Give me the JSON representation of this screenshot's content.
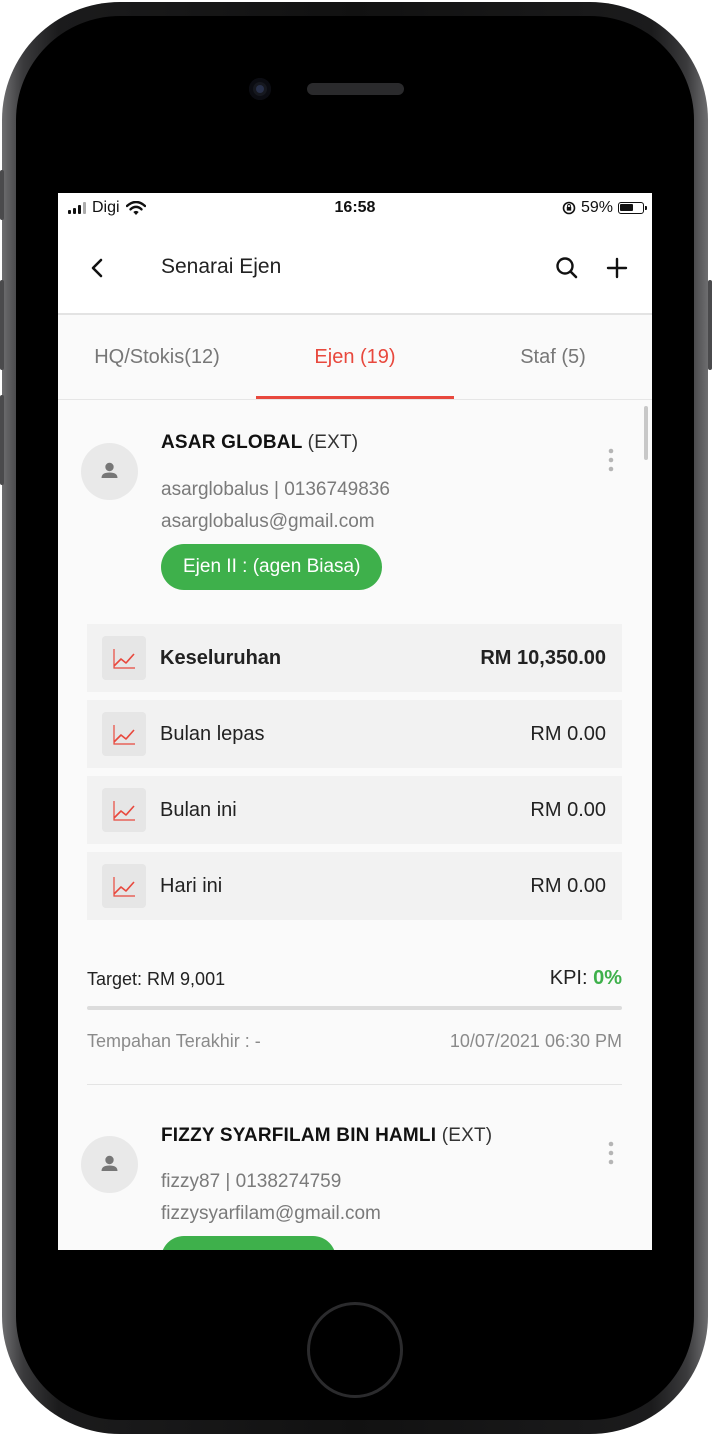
{
  "status_bar": {
    "carrier": "Digi",
    "time": "16:58",
    "battery": "59%"
  },
  "header": {
    "title": "Senarai Ejen",
    "icons": [
      "chevron-left-icon",
      "search-icon",
      "plus-icon"
    ]
  },
  "tabs": [
    {
      "label": "HQ/Stokis(12)",
      "active": false
    },
    {
      "label": "Ejen (19)",
      "active": true
    },
    {
      "label": "Staf (5)",
      "active": false
    }
  ],
  "colors": {
    "accent": "#e8483d",
    "badge": "#3eb04b",
    "kpi": "#3eb04b"
  },
  "agents": [
    {
      "name": "ASAR GLOBAL",
      "tag": "(EXT)",
      "username_phone": "asarglobalus | 0136749836",
      "email": "asarglobalus@gmail.com",
      "level": "Ejen II : (agen Biasa)",
      "stats": [
        {
          "label": "Keseluruhan",
          "value": "RM 10,350.00"
        },
        {
          "label": "Bulan lepas",
          "value": "RM 0.00"
        },
        {
          "label": "Bulan ini",
          "value": "RM 0.00"
        },
        {
          "label": "Hari ini",
          "value": "RM 0.00"
        }
      ],
      "target_label": "Target:",
      "target_value": "RM 9,001",
      "kpi_label": "KPI:",
      "kpi_value": "0%",
      "kpi_fraction": 0,
      "last_order": "Tempahan Terakhir : -",
      "last_date": "10/07/2021 06:30 PM"
    },
    {
      "name": "FIZZY SYARFILAM BIN HAMLI",
      "tag": "(EXT)",
      "username_phone": "fizzy87 | 0138274759",
      "email": "fizzysyarfilam@gmail.com"
    }
  ]
}
